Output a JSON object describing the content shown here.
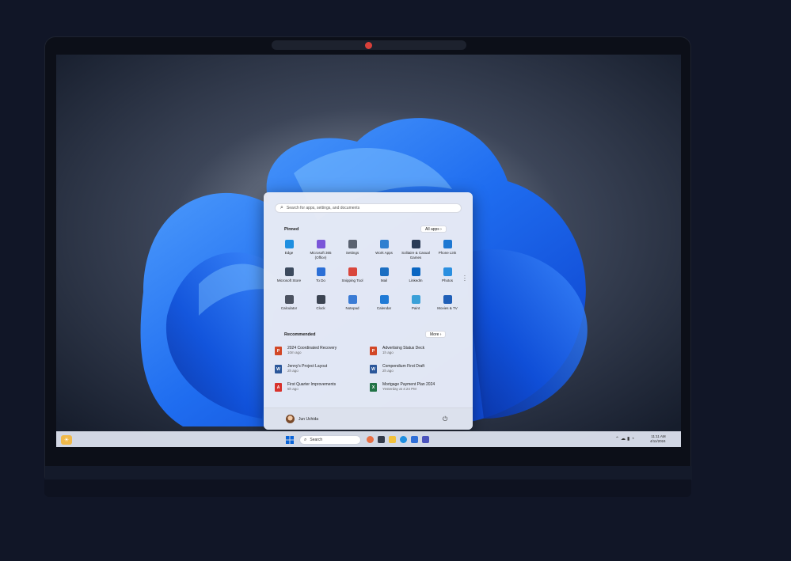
{
  "start_menu": {
    "search_placeholder": "Search for apps, settings, and documents",
    "pinned_title": "Pinned",
    "all_apps_label": "All apps ›",
    "pinned_apps": [
      {
        "label": "Edge",
        "icon": "edge-icon",
        "color": "#1f8fe0"
      },
      {
        "label": "Microsoft 365 (Office)",
        "icon": "office-icon",
        "color": "#7a55d8"
      },
      {
        "label": "Settings",
        "icon": "settings-icon",
        "color": "#5a6270"
      },
      {
        "label": "Work Apps",
        "icon": "work-apps-icon",
        "color": "#2f7fd0"
      },
      {
        "label": "Solitaire & Casual Games",
        "icon": "solitaire-icon",
        "color": "#2a3b56"
      },
      {
        "label": "Phone Link",
        "icon": "phone-link-icon",
        "color": "#1e78d2"
      },
      {
        "label": "Microsoft Store",
        "icon": "store-icon",
        "color": "#3c4a5e"
      },
      {
        "label": "To Do",
        "icon": "todo-icon",
        "color": "#2b6fd6"
      },
      {
        "label": "Snipping Tool",
        "icon": "snipping-tool-icon",
        "color": "#d9463c"
      },
      {
        "label": "Mail",
        "icon": "mail-icon",
        "color": "#1b6ec2"
      },
      {
        "label": "LinkedIn",
        "icon": "linkedin-icon",
        "color": "#0a66c2"
      },
      {
        "label": "Photos",
        "icon": "photos-icon",
        "color": "#2a8fe0"
      },
      {
        "label": "Calculator",
        "icon": "calculator-icon",
        "color": "#4b5260"
      },
      {
        "label": "Clock",
        "icon": "clock-icon",
        "color": "#3c4452"
      },
      {
        "label": "Notepad",
        "icon": "notepad-icon",
        "color": "#3a7bd5"
      },
      {
        "label": "Calendar",
        "icon": "calendar-icon",
        "color": "#1f7ad6"
      },
      {
        "label": "Paint",
        "icon": "paint-icon",
        "color": "#3aa0d8"
      },
      {
        "label": "Movies & TV",
        "icon": "movies-icon",
        "color": "#1f5fb8"
      }
    ],
    "recommended_title": "Recommended",
    "more_label": "More ›",
    "recommended": [
      {
        "title": "2024 Coordinated Recovery",
        "time": "10m ago",
        "icon": "powerpoint-icon",
        "color": "#d24726",
        "glyph": "P"
      },
      {
        "title": "Advertising Status Deck",
        "time": "1h ago",
        "icon": "powerpoint-icon",
        "color": "#d24726",
        "glyph": "P"
      },
      {
        "title": "Jenny's Project Layout",
        "time": "2h ago",
        "icon": "word-icon",
        "color": "#2b579a",
        "glyph": "W"
      },
      {
        "title": "Compendium First Draft",
        "time": "2h ago",
        "icon": "word-icon",
        "color": "#2b579a",
        "glyph": "W"
      },
      {
        "title": "First Quarter Improvements",
        "time": "5h ago",
        "icon": "pdf-icon",
        "color": "#d8322c",
        "glyph": "A"
      },
      {
        "title": "Mortgage Payment Plan 2024",
        "time": "Yesterday at 4:24 PM",
        "icon": "excel-icon",
        "color": "#217346",
        "glyph": "X"
      }
    ],
    "user_name": "Jun Uchida",
    "power_glyph": "⏻"
  },
  "taskbar": {
    "search_label": "Search",
    "time": "11:11 AM",
    "date": "4/11/2024"
  }
}
